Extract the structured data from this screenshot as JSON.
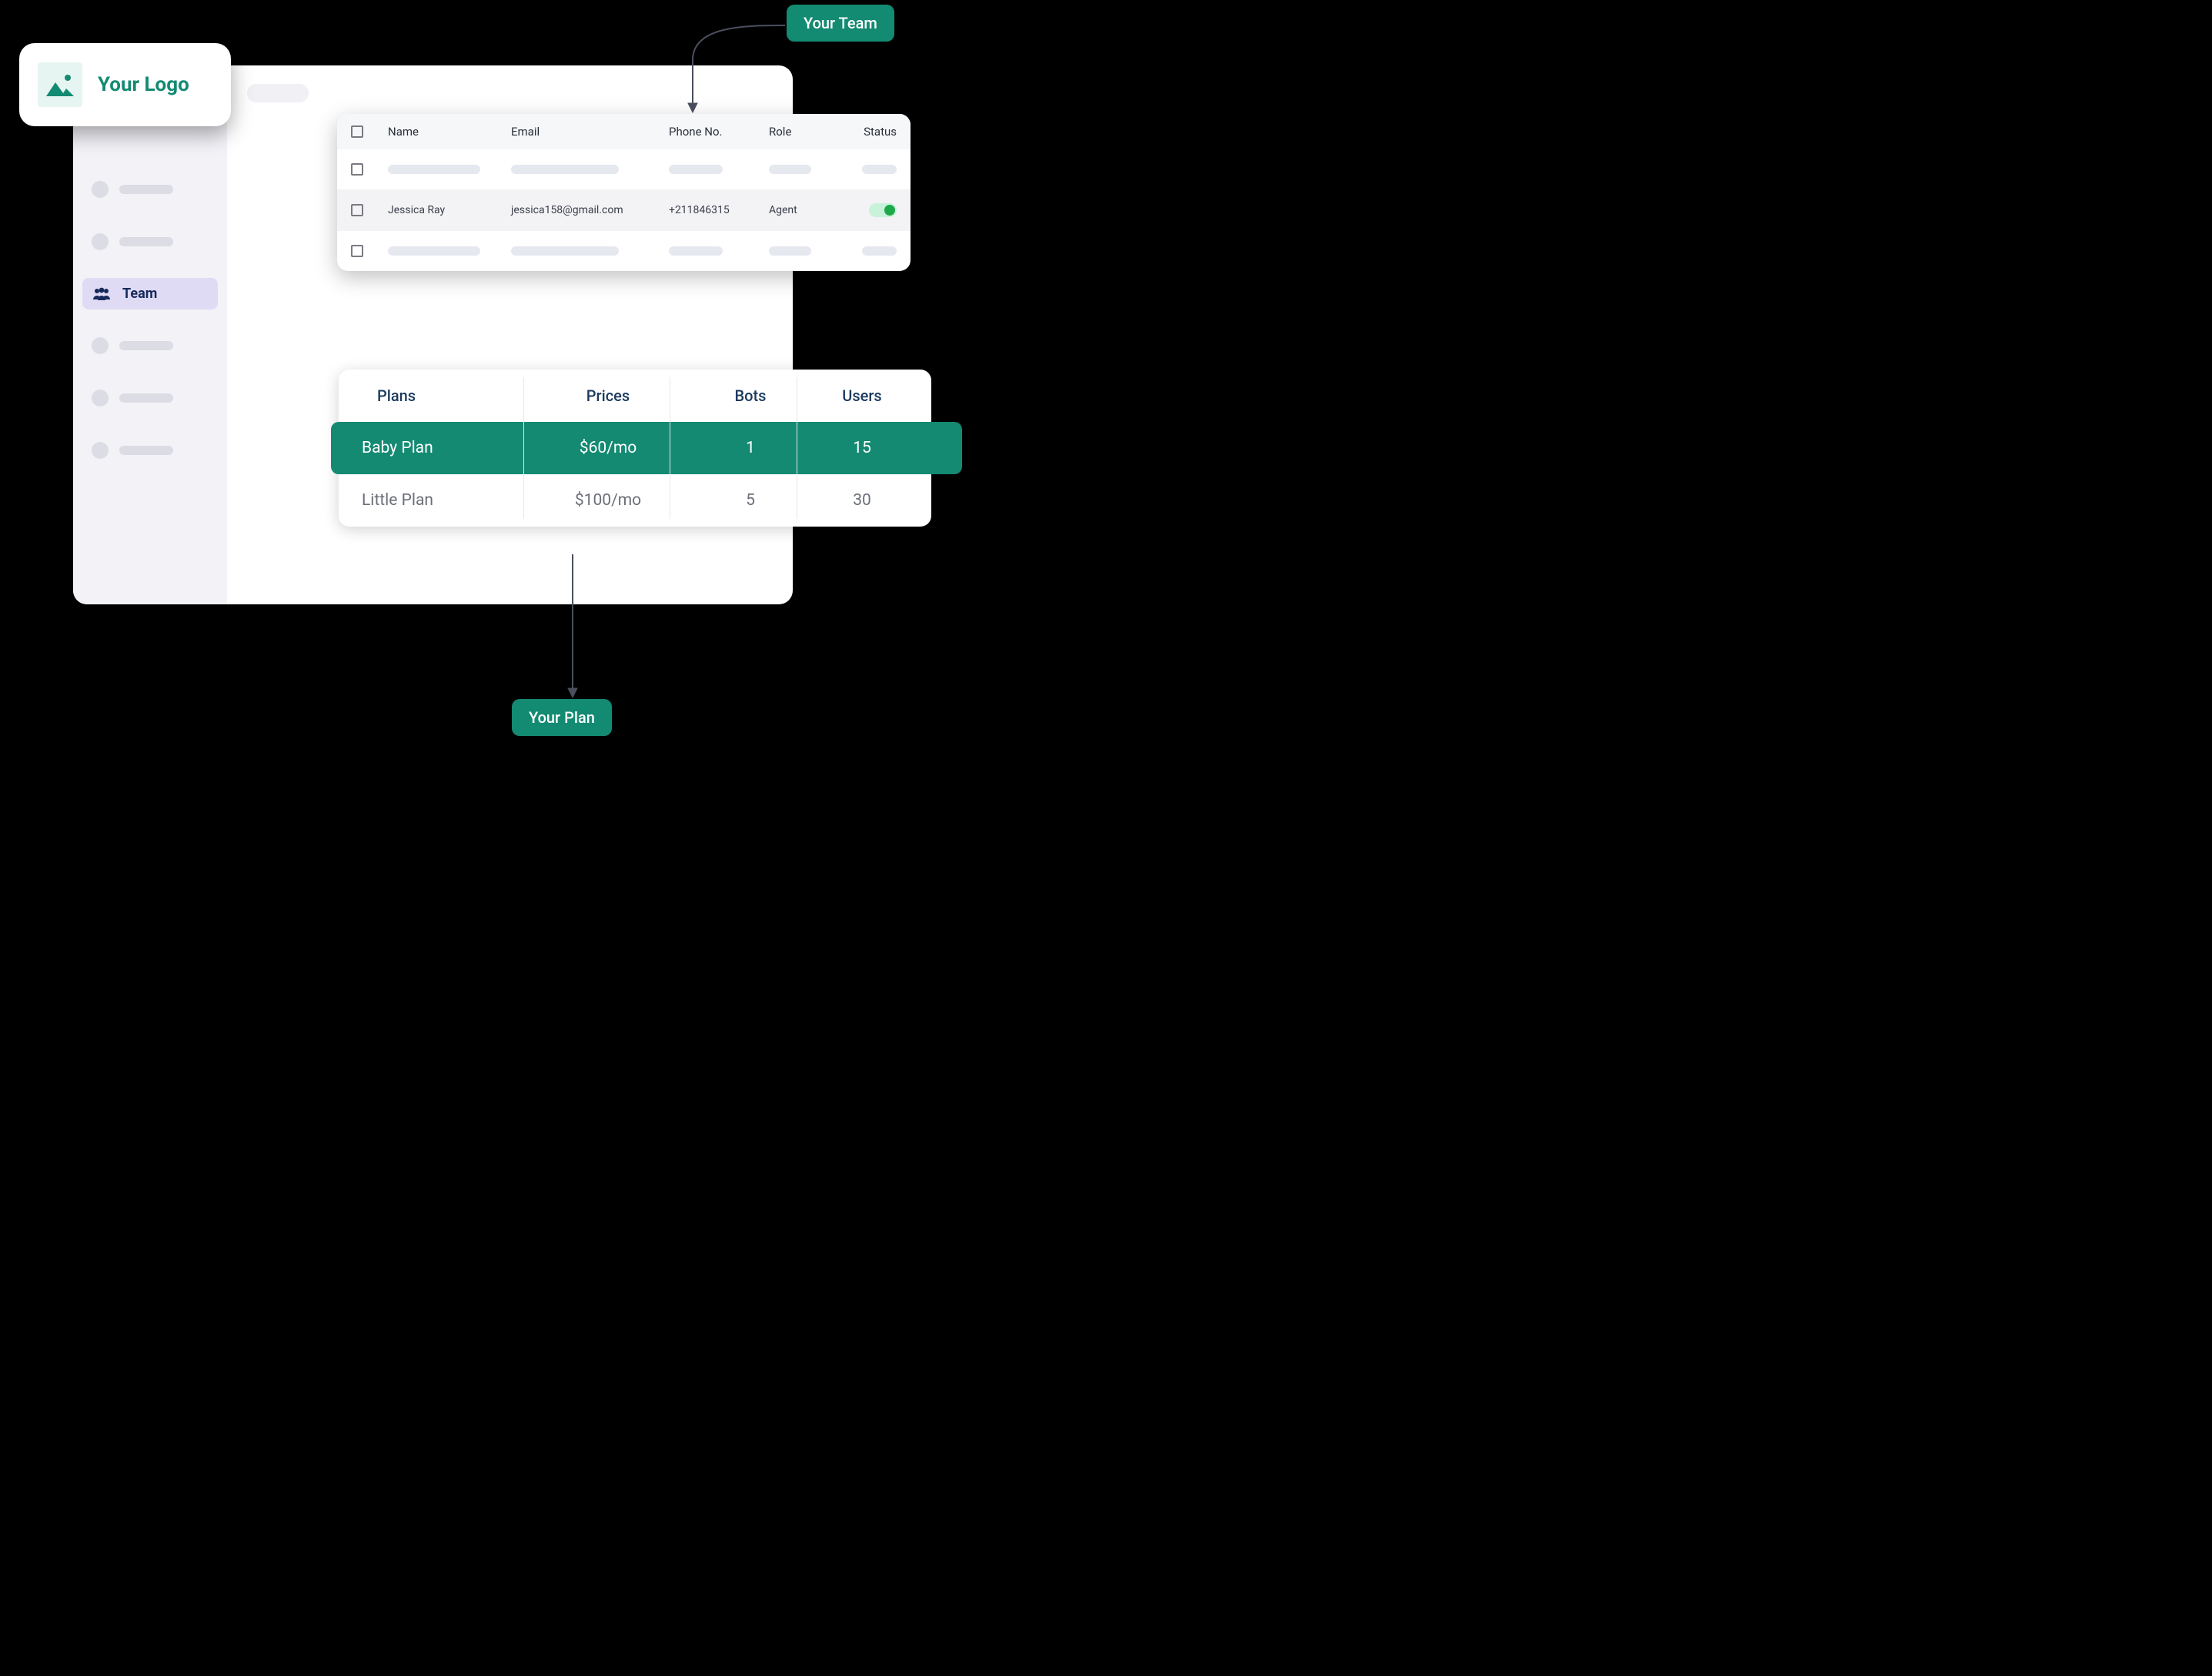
{
  "logo": {
    "label": "Your Logo"
  },
  "sidebar": {
    "active_label": "Team"
  },
  "team_table": {
    "headers": {
      "name": "Name",
      "email": "Email",
      "phone": "Phone No.",
      "role": "Role",
      "status": "Status"
    },
    "row": {
      "name": "Jessica Ray",
      "email": "jessica158@gmail.com",
      "phone": "+211846315",
      "role": "Agent"
    }
  },
  "plans": {
    "headers": {
      "plans": "Plans",
      "prices": "Prices",
      "bots": "Bots",
      "users": "Users"
    },
    "rows": [
      {
        "name": "Baby Plan",
        "price": "$60/mo",
        "bots": "1",
        "users": "15",
        "selected": true
      },
      {
        "name": "Little Plan",
        "price": "$100/mo",
        "bots": "5",
        "users": "30",
        "selected": false
      }
    ]
  },
  "callouts": {
    "team": "Your Team",
    "plan": "Your Plan"
  }
}
